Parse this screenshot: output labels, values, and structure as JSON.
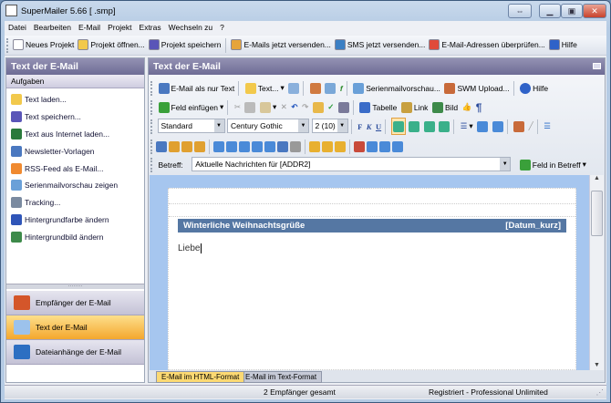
{
  "window": {
    "title": "SuperMailer 5.66 [            .smp]"
  },
  "menu": [
    "Datei",
    "Bearbeiten",
    "E-Mail",
    "Projekt",
    "Extras",
    "Wechseln zu",
    "?"
  ],
  "main_toolbar": [
    {
      "label": "Neues Projekt",
      "icon": "new-document-icon",
      "color": "#ffffff"
    },
    {
      "label": "Projekt öffnen...",
      "icon": "folder-open-icon",
      "color": "#f2c94c"
    },
    {
      "label": "Projekt speichern",
      "icon": "save-icon",
      "color": "#5a55b8"
    },
    {
      "label": "E-Mails jetzt versenden...",
      "icon": "send-mail-icon",
      "color": "#e6a43a"
    },
    {
      "label": "SMS jetzt versenden...",
      "icon": "sms-icon",
      "color": "#3b7fc4"
    },
    {
      "label": "E-Mail-Adressen überprüfen...",
      "icon": "check-address-icon",
      "color": "#e04b3a"
    },
    {
      "label": "Hilfe",
      "icon": "help-icon",
      "color": "#2f62c8"
    }
  ],
  "left_panel": {
    "title": "Text der E-Mail",
    "section": "Aufgaben",
    "tasks": [
      {
        "label": "Text laden...",
        "icon": "folder-open-icon",
        "color": "#f2c94c"
      },
      {
        "label": "Text speichern...",
        "icon": "save-icon",
        "color": "#5a55b8"
      },
      {
        "label": "Text aus Internet laden...",
        "icon": "globe-icon",
        "color": "#2a7a3c"
      },
      {
        "label": "Newsletter-Vorlagen",
        "icon": "template-icon",
        "color": "#4a78c0"
      },
      {
        "label": "RSS-Feed als E-Mail...",
        "icon": "rss-icon",
        "color": "#f08a30"
      },
      {
        "label": "Serienmailvorschau zeigen",
        "icon": "preview-icon",
        "color": "#6aa0d8"
      },
      {
        "label": "Tracking...",
        "icon": "tracking-icon",
        "color": "#7a8aa0"
      },
      {
        "label": "Hintergrundfarbe ändern",
        "icon": "background-color-icon",
        "color": "#2f55b8"
      },
      {
        "label": "Hintergrundbild ändern",
        "icon": "background-image-icon",
        "color": "#3d8a4a"
      }
    ],
    "nav": [
      {
        "label": "Empfänger der E-Mail",
        "icon": "recipients-icon",
        "color": "#d4562a",
        "active": false
      },
      {
        "label": "Text der E-Mail",
        "icon": "email-text-icon",
        "color": "#9cc2ec",
        "active": true
      },
      {
        "label": "Dateianhänge der E-Mail",
        "icon": "paperclip-icon",
        "color": "#2d6fc2",
        "active": false
      }
    ]
  },
  "right_panel": {
    "title": "Text der E-Mail",
    "row1": {
      "plain_text": "E-Mail als nur Text",
      "text": "Text...",
      "preview": "Serienmailvorschau...",
      "upload": "SWM Upload...",
      "help": "Hilfe"
    },
    "row2": {
      "insert_field": "Feld einfügen",
      "table": "Tabelle",
      "link": "Link",
      "image": "Bild",
      "pilcrow": "¶"
    },
    "row3": {
      "style": "Standard",
      "font": "Century Gothic",
      "size": "2 (10)",
      "bold": "F",
      "italic": "K",
      "underline": "U"
    },
    "subject_label": "Betreff:",
    "subject_value": "Aktuelle Nachrichten für [ADDR2]",
    "field_in_subject": "Feld in Betreff"
  },
  "editor": {
    "banner_title": "Winterliche Weihnachtsgrüße",
    "banner_date": "[Datum_kurz]",
    "body": "Liebe"
  },
  "tabs": [
    "E-Mail im HTML-Format",
    "E-Mail im Text-Format"
  ],
  "status": {
    "recipients": "2 Empfänger gesamt",
    "license": "Registriert - Professional Unlimited"
  }
}
